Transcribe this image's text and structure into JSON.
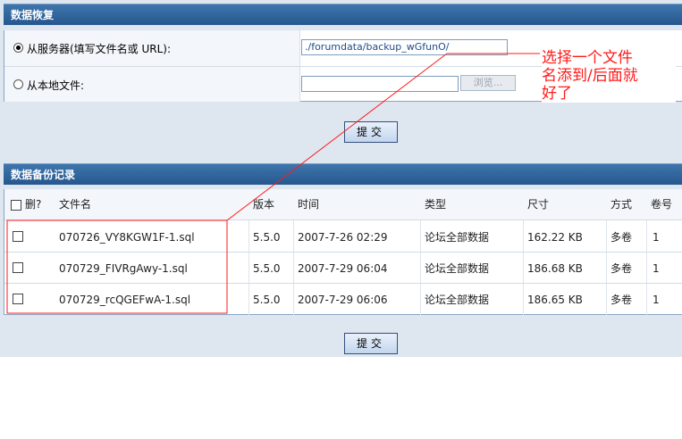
{
  "restore": {
    "header": "数据恢复",
    "server_label": "从服务器(填写文件名或 URL):",
    "server_value": "./forumdata/backup_wGfunO/",
    "local_label": "从本地文件:",
    "local_value": "",
    "browse_label": "浏览...",
    "submit_label": "提交"
  },
  "annotation": {
    "lines": [
      "选择一个文件",
      "名添到/后面就",
      "好了"
    ],
    "color": "#ff1a1a"
  },
  "backups": {
    "header": "数据备份记录",
    "columns": [
      "删?",
      "文件名",
      "版本",
      "时间",
      "类型",
      "尺寸",
      "方式",
      "卷号"
    ],
    "rows": [
      {
        "file": "070726_VY8KGW1F-1.sql",
        "version": "5.5.0",
        "time": "2007-7-26 02:29",
        "type": "论坛全部数据",
        "size": "162.22 KB",
        "method": "多卷",
        "volume": "1"
      },
      {
        "file": "070729_FIVRgAwy-1.sql",
        "version": "5.5.0",
        "time": "2007-7-29 06:04",
        "type": "论坛全部数据",
        "size": "186.68 KB",
        "method": "多卷",
        "volume": "1"
      },
      {
        "file": "070729_rcQGEFwA-1.sql",
        "version": "5.5.0",
        "time": "2007-7-29 06:06",
        "type": "论坛全部数据",
        "size": "186.65 KB",
        "method": "多卷",
        "volume": "1"
      }
    ],
    "submit_label": "提交"
  }
}
